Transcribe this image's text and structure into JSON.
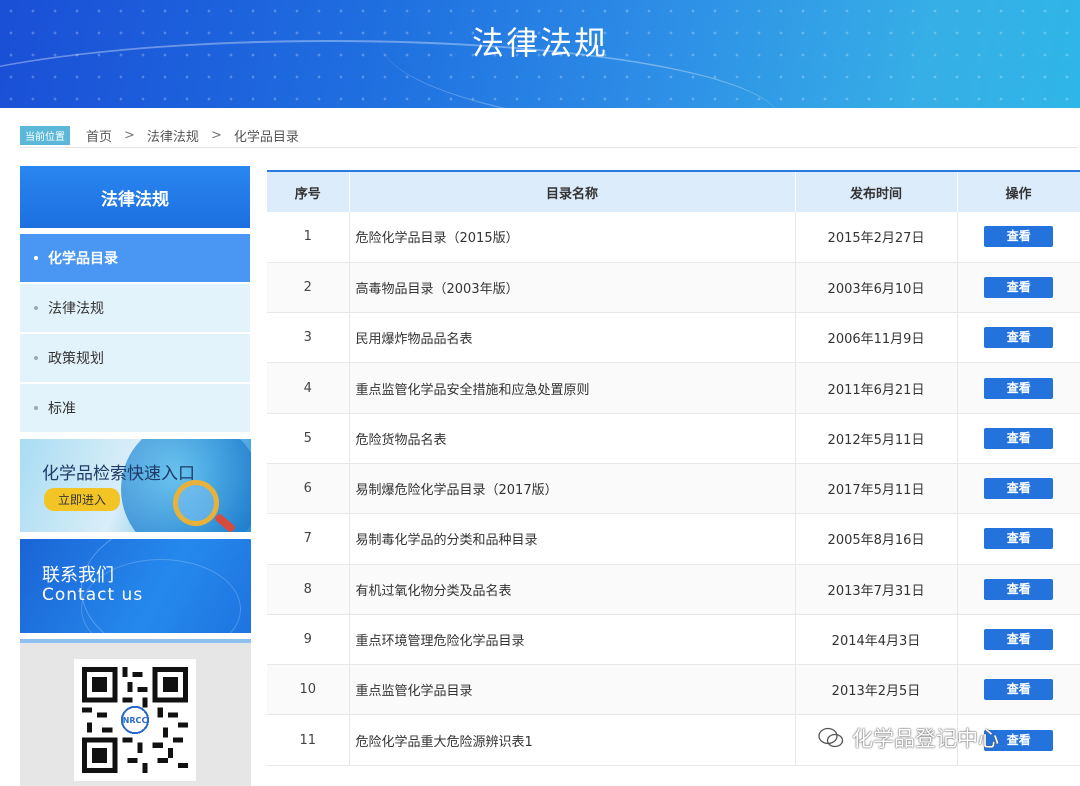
{
  "banner": {
    "title": "法律法规"
  },
  "breadcrumb": {
    "badge": "当前位置",
    "items": [
      "首页",
      "法律法规",
      "化学品目录"
    ],
    "separator": ">"
  },
  "sidebar": {
    "title": "法律法规",
    "items": [
      {
        "label": "化学品目录",
        "active": true
      },
      {
        "label": "法律法规",
        "active": false
      },
      {
        "label": "政策规划",
        "active": false
      },
      {
        "label": "标准",
        "active": false
      }
    ],
    "promo": {
      "title": "化学品检索快速入口",
      "button": "立即进入"
    },
    "contact": {
      "cn": "联系我们",
      "en": "Contact us"
    },
    "qr_label": "NRCC"
  },
  "table": {
    "headers": {
      "idx": "序号",
      "name": "目录名称",
      "date": "发布时间",
      "op": "操作"
    },
    "rows": [
      {
        "idx": "1",
        "name": "危险化学品目录（2015版）",
        "date": "2015年2月27日",
        "op": "查看"
      },
      {
        "idx": "2",
        "name": "高毒物品目录（2003年版）",
        "date": "2003年6月10日",
        "op": "查看"
      },
      {
        "idx": "3",
        "name": "民用爆炸物品品名表",
        "date": "2006年11月9日",
        "op": "查看"
      },
      {
        "idx": "4",
        "name": "重点监管化学品安全措施和应急处置原则",
        "date": "2011年6月21日",
        "op": "查看"
      },
      {
        "idx": "5",
        "name": "危险货物品名表",
        "date": "2012年5月11日",
        "op": "查看"
      },
      {
        "idx": "6",
        "name": "易制爆危险化学品目录（2017版）",
        "date": "2017年5月11日",
        "op": "查看"
      },
      {
        "idx": "7",
        "name": "易制毒化学品的分类和品种目录",
        "date": "2005年8月16日",
        "op": "查看"
      },
      {
        "idx": "8",
        "name": "有机过氧化物分类及品名表",
        "date": "2013年7月31日",
        "op": "查看"
      },
      {
        "idx": "9",
        "name": "重点环境管理危险化学品目录",
        "date": "2014年4月3日",
        "op": "查看"
      },
      {
        "idx": "10",
        "name": "重点监管化学品目录",
        "date": "2013年2月5日",
        "op": "查看"
      },
      {
        "idx": "11",
        "name": "危险化学品重大危险源辨识表1",
        "date": "",
        "op": "查看"
      }
    ]
  },
  "watermark": {
    "text": "化学品登记中心"
  },
  "colors": {
    "primary": "#2472dc",
    "header_bg": "#dcecfb",
    "sidebar_active": "#4a97f3",
    "sidebar_item": "#e3f3fb"
  }
}
